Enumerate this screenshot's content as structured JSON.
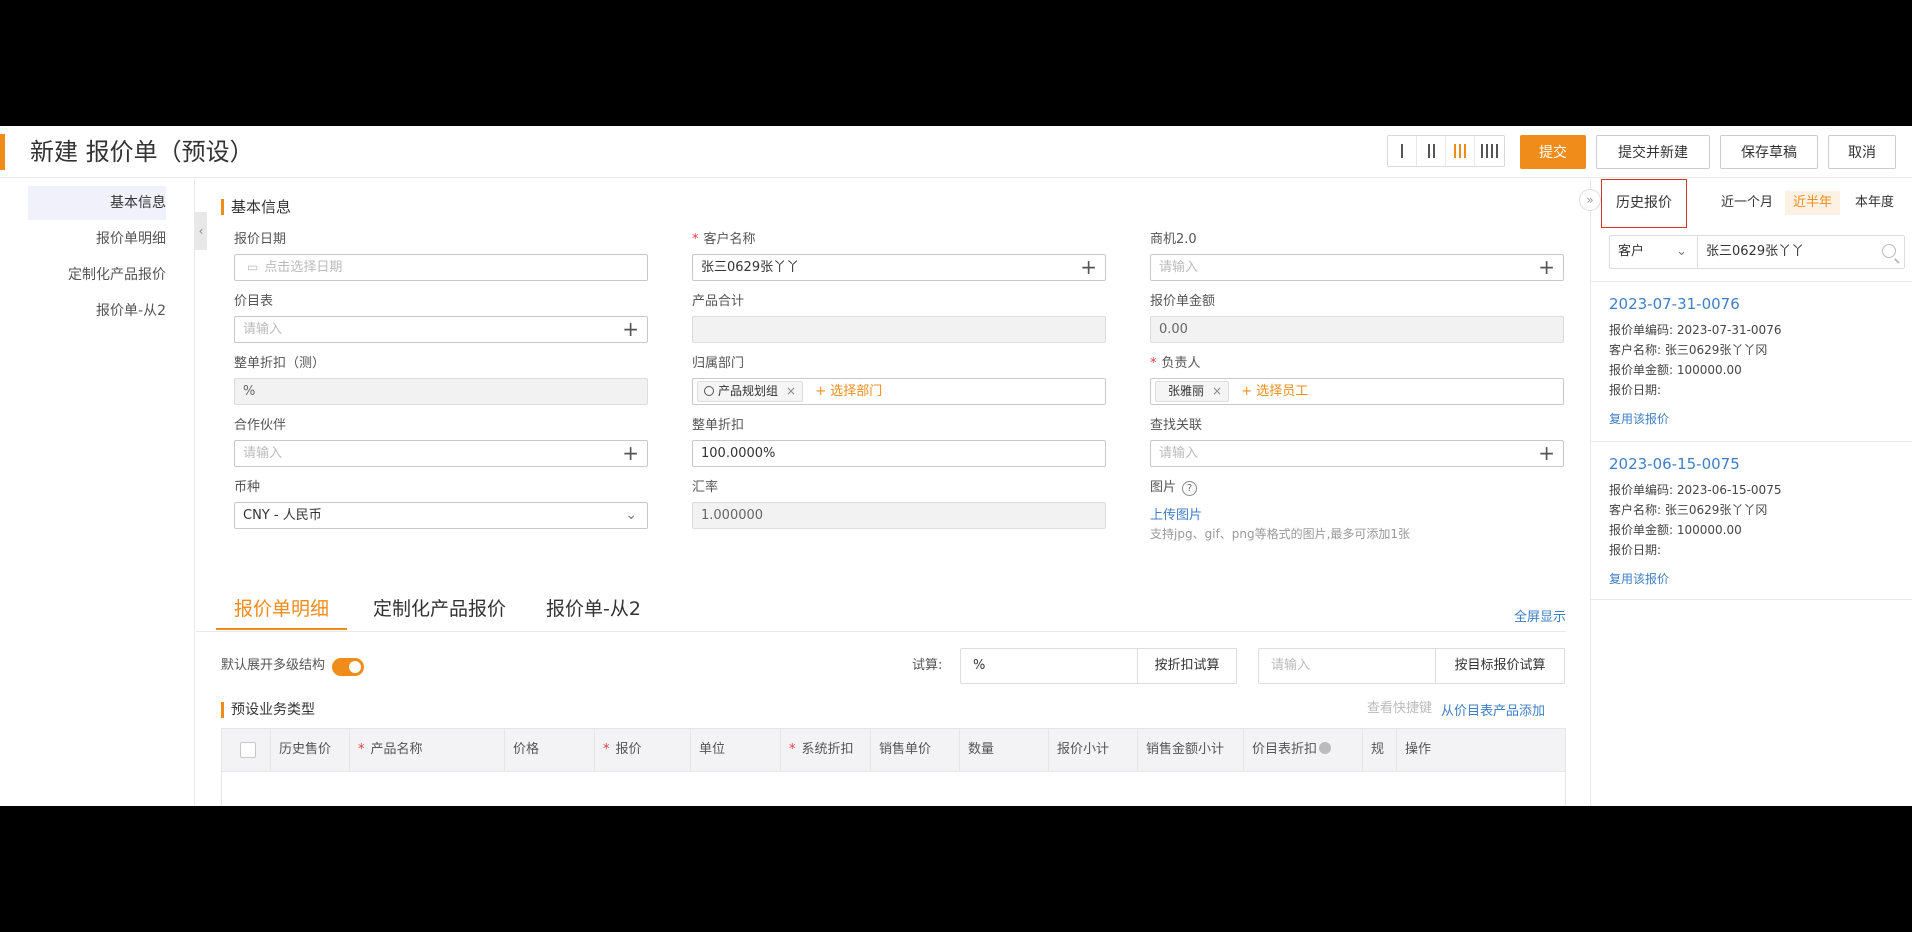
{
  "header": {
    "title": "新建 报价单（预设）",
    "submit": "提交",
    "submit_new": "提交并新建",
    "save_draft": "保存草稿",
    "cancel": "取消"
  },
  "leftnav": {
    "items": [
      "基本信息",
      "报价单明细",
      "定制化产品报价",
      "报价单-从2"
    ]
  },
  "form": {
    "section_title": "基本信息",
    "quote_date": {
      "label": "报价日期",
      "placeholder": "点击选择日期"
    },
    "customer": {
      "label": "客户名称",
      "value": "张三0629张丫丫"
    },
    "opportunity": {
      "label": "商机2.0",
      "placeholder": "请输入"
    },
    "price_list": {
      "label": "价目表",
      "placeholder": "请输入"
    },
    "product_total": {
      "label": "产品合计",
      "value": ""
    },
    "quote_amount": {
      "label": "报价单金额",
      "value": "0.00"
    },
    "discount_test": {
      "label": "整单折扣（测）",
      "value": "%"
    },
    "department": {
      "label": "归属部门",
      "tag": "产品规划组",
      "add_label": "+ 选择部门"
    },
    "owner": {
      "label": "负责人",
      "tag": "张雅丽",
      "add_label": "+ 选择员工"
    },
    "partner": {
      "label": "合作伙伴",
      "placeholder": "请输入"
    },
    "discount": {
      "label": "整单折扣",
      "value": "100.0000%"
    },
    "lookup": {
      "label": "查找关联",
      "placeholder": "请输入"
    },
    "currency": {
      "label": "币种",
      "value": "CNY - 人民币"
    },
    "exchange_rate": {
      "label": "汇率",
      "value": "1.000000"
    },
    "image": {
      "label": "图片",
      "upload": "上传图片",
      "hint": "支持jpg、gif、png等格式的图片,最多可添加1张"
    }
  },
  "tabs": {
    "items": [
      "报价单明细",
      "定制化产品报价",
      "报价单-从2"
    ],
    "fullscreen": "全屏显示"
  },
  "detail": {
    "expand_label": "默认展开多级结构",
    "trial_label": "试算:",
    "trial_value": "%",
    "discount_calc": "按折扣试算",
    "target_placeholder": "请输入",
    "target_calc": "按目标报价试算",
    "sub_title": "预设业务类型",
    "shortcut": "查看快捷键",
    "add_from_price_list": "从价目表产品添加",
    "columns": [
      "历史售价",
      "产品名称",
      "价格",
      "报价",
      "单位",
      "系统折扣",
      "销售单价",
      "数量",
      "报价小计",
      "销售金额小计",
      "价目表折扣",
      "规格",
      "操作"
    ]
  },
  "history": {
    "title": "历史报价",
    "ranges": [
      "近一个月",
      "近半年",
      "本年度"
    ],
    "filter_type": "客户",
    "filter_value": "张三0629张丫丫",
    "records": [
      {
        "code": "2023-07-31-0076",
        "number": "报价单编码: 2023-07-31-0076",
        "customer": "客户名称: 张三0629张丫丫冈",
        "amount": "报价单金额: 100000.00",
        "date": "报价日期:",
        "reuse": "复用该报价"
      },
      {
        "code": "2023-06-15-0075",
        "number": "报价单编码: 2023-06-15-0075",
        "customer": "客户名称: 张三0629张丫丫冈",
        "amount": "报价单金额: 100000.00",
        "date": "报价日期:",
        "reuse": "复用该报价"
      }
    ]
  },
  "colors": {
    "accent": "#f08c1a",
    "link": "#3d7ec7",
    "required": "#e4393c",
    "highlight_border": "#d9342b"
  }
}
